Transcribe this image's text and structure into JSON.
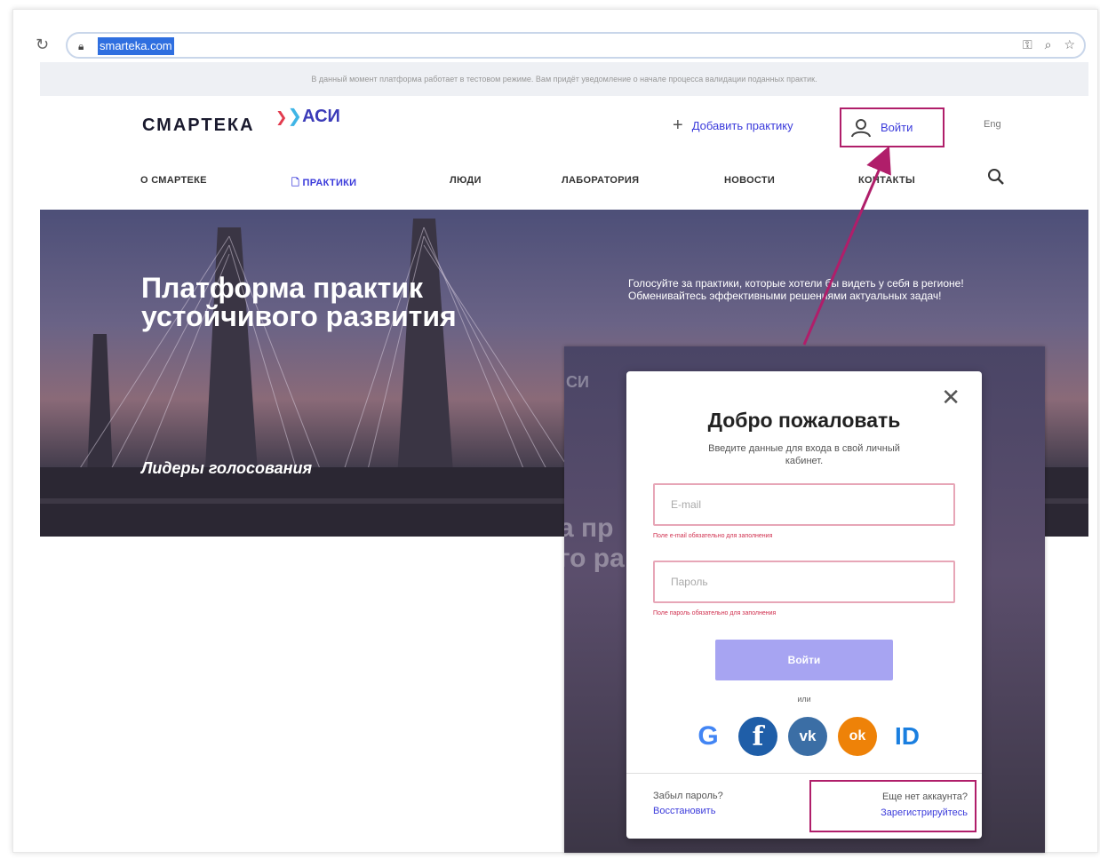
{
  "browser": {
    "url": "smarteka.com"
  },
  "notice": "В данный момент платформа работает в тестовом режиме. Вам придёт уведомление о начале процесса валидации поданных практик.",
  "header": {
    "logo": "СМАРТЕКА",
    "logo_partner": "АСИ",
    "add_practice": "Добавить практику",
    "login": "Войти",
    "lang": "Eng"
  },
  "nav": {
    "items": [
      "О СМАРТЕКЕ",
      "ПРАКТИКИ",
      "ЛЮДИ",
      "ЛАБОРАТОРИЯ",
      "НОВОСТИ",
      "КОНТАКТЫ"
    ]
  },
  "hero": {
    "title_line1": "Платформа практик",
    "title_line2": "устойчивого развития",
    "text": "Голосуйте за практики, которые хотели бы видеть у себя в регионе! Обменивайтесь эффективными решениями актуальных задач!",
    "leaders": "Лидеры голосования"
  },
  "modal": {
    "title": "Добро пожаловать",
    "subtitle": "Введите данные для входа в свой личный кабинет.",
    "email_placeholder": "E-mail",
    "email_error": "Поле e-mail обязательно для заполнения",
    "password_placeholder": "Пароль",
    "password_error": "Поле пароль обязательно для заполнения",
    "submit": "Войти",
    "or": "или",
    "social": [
      "G",
      "f",
      "vk",
      "ok",
      "ID"
    ],
    "forgot_label": "Забыл пароль?",
    "restore_link": "Восстановить",
    "no_account_label": "Еще нет аккаунта?",
    "register_link": "Зарегистрируйтесь"
  },
  "colors": {
    "accent": "#3b3bdb",
    "highlight": "#b01e6a",
    "submit": "#a7a4f2"
  }
}
